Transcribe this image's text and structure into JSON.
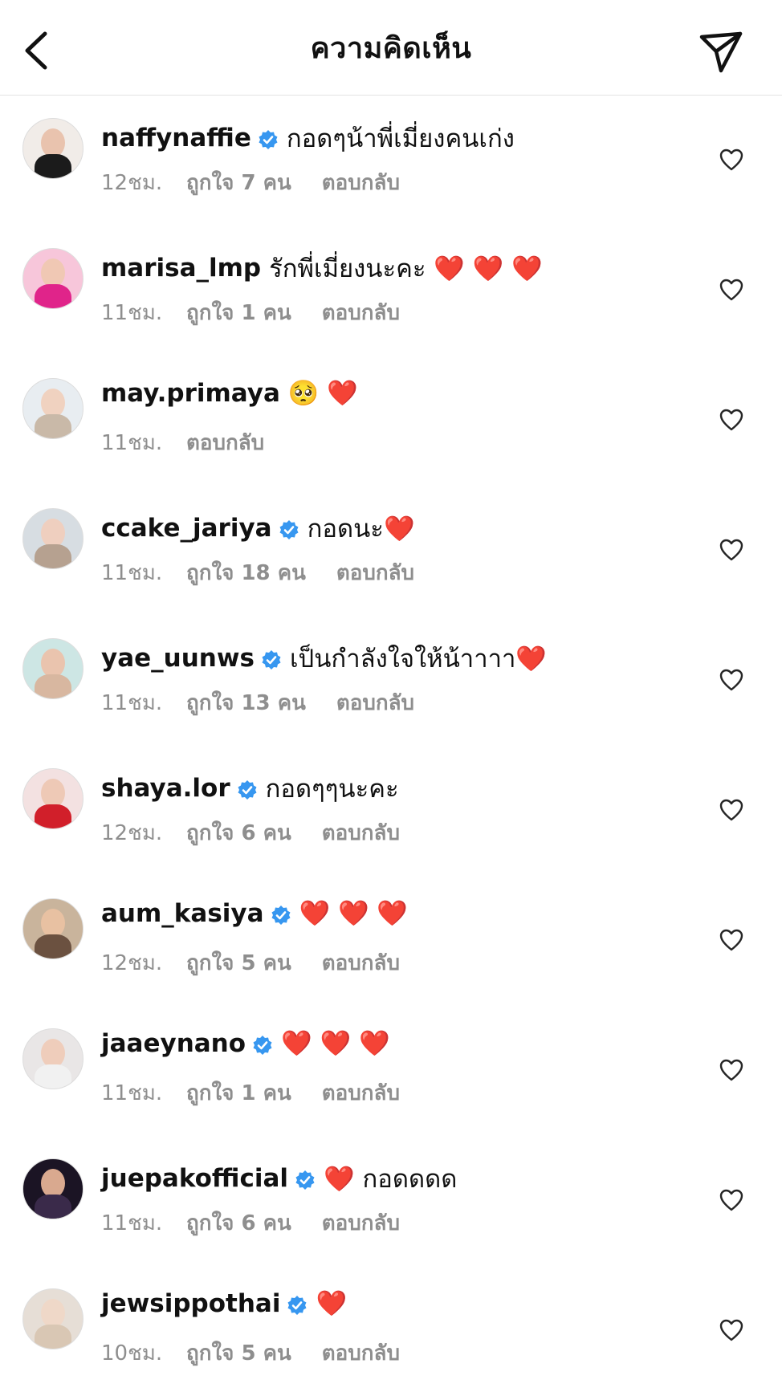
{
  "header": {
    "title": "ความคิดเห็น"
  },
  "comments": [
    {
      "username": "naffynaffie",
      "verified": true,
      "text": "กอดๆน้าพี่เมี่ยงคนเก่ง",
      "time": "12ชม.",
      "likes": "ถูกใจ 7 คน",
      "reply": "ตอบกลับ",
      "avatar_bg": "#f1ece8",
      "skin": "#e9c3ae",
      "body": "#1b1b1b"
    },
    {
      "username": "marisa_lmp",
      "verified": false,
      "text": "รักพี่เมี่ยงนะคะ ❤️ ❤️ ❤️",
      "time": "11ชม.",
      "likes": "ถูกใจ 1 คน",
      "reply": "ตอบกลับ",
      "avatar_bg": "#f7c6da",
      "skin": "#f0c8b4",
      "body": "#e0248a"
    },
    {
      "username": "may.primaya",
      "verified": false,
      "text": "🥺 ❤️",
      "time": "11ชม.",
      "likes": "",
      "reply": "ตอบกลับ",
      "avatar_bg": "#e8edf1",
      "skin": "#f0d2c0",
      "body": "#c9b9a8"
    },
    {
      "username": "ccake_jariya",
      "verified": true,
      "text": "กอดนะ❤️",
      "time": "11ชม.",
      "likes": "ถูกใจ 18 คน",
      "reply": "ตอบกลับ",
      "avatar_bg": "#d7dde2",
      "skin": "#efcfbf",
      "body": "#b6a190"
    },
    {
      "username": "yae_uunws",
      "verified": true,
      "text": "เป็นกำลังใจให้น้าาาา❤️",
      "time": "11ชม.",
      "likes": "ถูกใจ 13 คน",
      "reply": "ตอบกลับ",
      "avatar_bg": "#cde6e4",
      "skin": "#eac4ae",
      "body": "#d8b7a0"
    },
    {
      "username": "shaya.lor",
      "verified": true,
      "text": "กอดๆๆนะคะ",
      "time": "12ชม.",
      "likes": "ถูกใจ 6 คน",
      "reply": "ตอบกลับ",
      "avatar_bg": "#f3e1e1",
      "skin": "#eec9b6",
      "body": "#d11f2a"
    },
    {
      "username": "aum_kasiya",
      "verified": true,
      "text": "❤️ ❤️ ❤️",
      "time": "12ชม.",
      "likes": "ถูกใจ 5 คน",
      "reply": "ตอบกลับ",
      "avatar_bg": "#c9b49c",
      "skin": "#e8c1a2",
      "body": "#6b5140"
    },
    {
      "username": "jaaeynano",
      "verified": true,
      "text": "❤️ ❤️ ❤️",
      "time": "11ชม.",
      "likes": "ถูกใจ 1 คน",
      "reply": "ตอบกลับ",
      "avatar_bg": "#e9e6e6",
      "skin": "#efcdbb",
      "body": "#f1f1f1"
    },
    {
      "username": "juepakofficial",
      "verified": true,
      "text": "❤️ กอดดดด",
      "time": "11ชม.",
      "likes": "ถูกใจ 6 คน",
      "reply": "ตอบกลับ",
      "avatar_bg": "#1b1424",
      "skin": "#d9a98f",
      "body": "#3a2a4a"
    },
    {
      "username": "jewsippothai",
      "verified": true,
      "text": "❤️",
      "time": "10ชม.",
      "likes": "ถูกใจ 5 คน",
      "reply": "ตอบกลับ",
      "avatar_bg": "#e6ded6",
      "skin": "#efd8c8",
      "body": "#d9c7b4"
    }
  ],
  "icons": {
    "back": "chevron-left-icon",
    "send": "paper-plane-icon",
    "verified": "verified-badge-icon",
    "like": "heart-outline-icon"
  },
  "colors": {
    "verified": "#3797f0",
    "meta_text": "#8e8e8e",
    "divider": "#e3e3e3"
  }
}
